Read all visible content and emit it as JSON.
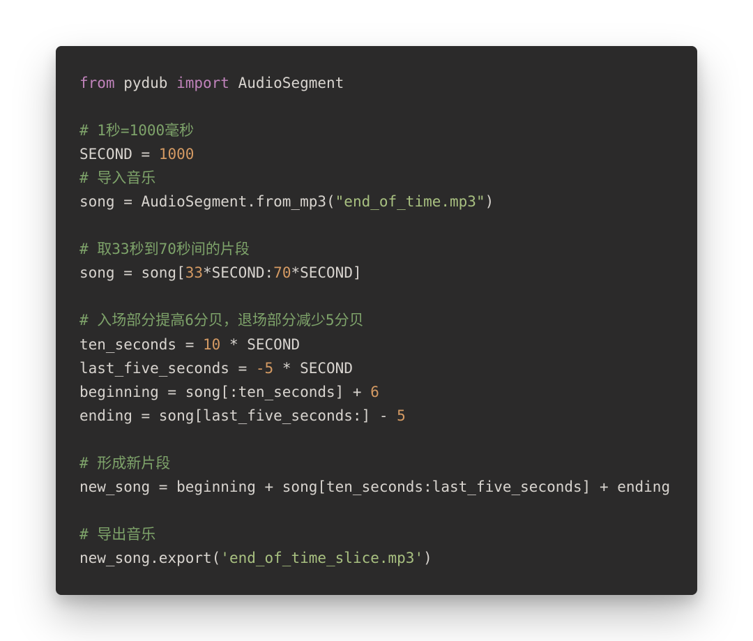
{
  "code": {
    "lines": [
      [
        {
          "cls": "kw",
          "t": "from"
        },
        {
          "cls": "id",
          "t": " pydub "
        },
        {
          "cls": "kw",
          "t": "import"
        },
        {
          "cls": "id",
          "t": " AudioSegment"
        }
      ],
      [
        {
          "cls": "id",
          "t": ""
        }
      ],
      [
        {
          "cls": "cm",
          "t": "# 1秒=1000毫秒"
        }
      ],
      [
        {
          "cls": "id",
          "t": "SECOND = "
        },
        {
          "cls": "num",
          "t": "1000"
        }
      ],
      [
        {
          "cls": "cm",
          "t": "# 导入音乐"
        }
      ],
      [
        {
          "cls": "id",
          "t": "song = AudioSegment.from_mp3("
        },
        {
          "cls": "str",
          "t": "\"end_of_time.mp3\""
        },
        {
          "cls": "id",
          "t": ")"
        }
      ],
      [
        {
          "cls": "id",
          "t": ""
        }
      ],
      [
        {
          "cls": "cm",
          "t": "# 取33秒到70秒间的片段"
        }
      ],
      [
        {
          "cls": "id",
          "t": "song = song["
        },
        {
          "cls": "num",
          "t": "33"
        },
        {
          "cls": "id",
          "t": "*SECOND:"
        },
        {
          "cls": "num",
          "t": "70"
        },
        {
          "cls": "id",
          "t": "*SECOND]"
        }
      ],
      [
        {
          "cls": "id",
          "t": ""
        }
      ],
      [
        {
          "cls": "cm",
          "t": "# 入场部分提高6分贝，退场部分减少5分贝"
        }
      ],
      [
        {
          "cls": "id",
          "t": "ten_seconds = "
        },
        {
          "cls": "num",
          "t": "10"
        },
        {
          "cls": "id",
          "t": " * SECOND"
        }
      ],
      [
        {
          "cls": "id",
          "t": "last_five_seconds = "
        },
        {
          "cls": "num",
          "t": "-5"
        },
        {
          "cls": "id",
          "t": " * SECOND"
        }
      ],
      [
        {
          "cls": "id",
          "t": "beginning = song[:ten_seconds] + "
        },
        {
          "cls": "num",
          "t": "6"
        }
      ],
      [
        {
          "cls": "id",
          "t": "ending = song[last_five_seconds:] - "
        },
        {
          "cls": "num",
          "t": "5"
        }
      ],
      [
        {
          "cls": "id",
          "t": ""
        }
      ],
      [
        {
          "cls": "cm",
          "t": "# 形成新片段"
        }
      ],
      [
        {
          "cls": "id",
          "t": "new_song = beginning + song[ten_seconds:last_five_seconds] + ending"
        }
      ],
      [
        {
          "cls": "id",
          "t": ""
        }
      ],
      [
        {
          "cls": "cm",
          "t": "# 导出音乐"
        }
      ],
      [
        {
          "cls": "id",
          "t": "new_song.export("
        },
        {
          "cls": "str",
          "t": "'end_of_time_slice.mp3'"
        },
        {
          "cls": "id",
          "t": ")"
        }
      ]
    ]
  }
}
